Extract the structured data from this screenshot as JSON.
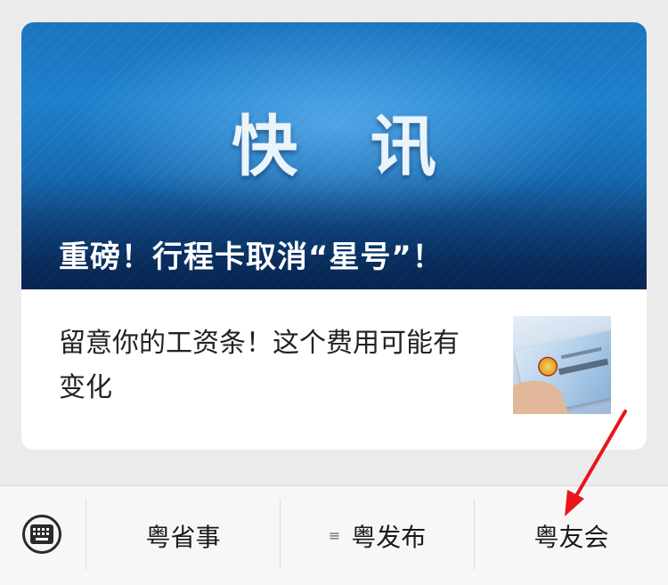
{
  "hero": {
    "word": "快 讯",
    "title": "重磅！行程卡取消“星号”！"
  },
  "article": {
    "title": "留意你的工资条！这个费用可能有变化",
    "thumbnail_icon": "social-security-card-image"
  },
  "bottom_menu": {
    "keyboard_icon": "keyboard-icon",
    "items": [
      {
        "label": "粤省事"
      },
      {
        "label": "粤发布",
        "icon": "submenu-lines-icon"
      },
      {
        "label": "粤友会"
      }
    ]
  },
  "colors": {
    "arrow": "#e8151b",
    "hero_blue": "#1d7fcb"
  }
}
